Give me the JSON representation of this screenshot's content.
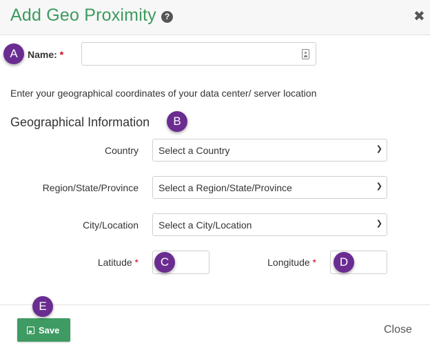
{
  "dialog": {
    "title": "Add Geo Proximity",
    "help_icon": "question-circle-icon",
    "close_icon": "close-x-icon"
  },
  "annotations": {
    "a": "A",
    "b": "B",
    "c": "C",
    "d": "D",
    "e": "E"
  },
  "form": {
    "name_label": "Name:",
    "required_mark": "*",
    "name_value": "",
    "intro_text": "Enter your geographical coordinates of your data center/ server location",
    "section_title": "Geographical Information",
    "country_label": "Country",
    "country_selected": "Select a Country",
    "region_label": "Region/State/Province",
    "region_selected": "Select a Region/State/Province",
    "city_label": "City/Location",
    "city_selected": "Select a City/Location",
    "latitude_label": "Latitude",
    "latitude_value": "",
    "longitude_label": "Longitude",
    "longitude_value": ""
  },
  "footer": {
    "save_label": "Save",
    "close_label": "Close"
  },
  "colors": {
    "title": "#3c9a5f",
    "save_button": "#3e9b63",
    "badge": "#6a2c91",
    "required": "#d0021b"
  }
}
